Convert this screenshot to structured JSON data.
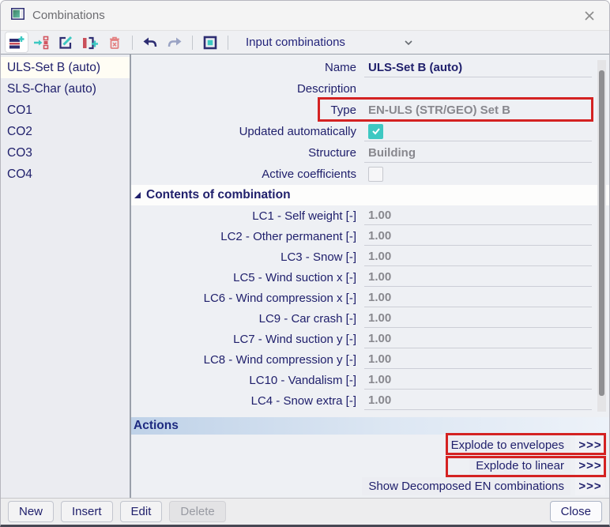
{
  "window": {
    "title": "Combinations"
  },
  "toolbar": {
    "dropdown_value": "Input combinations",
    "icons": [
      "new-combination",
      "move-combination",
      "edit-combination",
      "insert-combination",
      "delete-combination",
      "undo",
      "redo",
      "manager-box",
      "chevron-down"
    ]
  },
  "sidebar": {
    "items": [
      {
        "label": "ULS-Set B (auto)",
        "selected": true
      },
      {
        "label": "SLS-Char (auto)",
        "selected": false
      },
      {
        "label": "CO1",
        "selected": false
      },
      {
        "label": "CO2",
        "selected": false
      },
      {
        "label": "CO3",
        "selected": false
      },
      {
        "label": "CO4",
        "selected": false
      }
    ]
  },
  "properties": {
    "name": {
      "label": "Name",
      "value": "ULS-Set B (auto)"
    },
    "description": {
      "label": "Description",
      "value": ""
    },
    "type": {
      "label": "Type",
      "value": "EN-ULS (STR/GEO) Set B",
      "highlighted": true
    },
    "updated": {
      "label": "Updated automatically",
      "checked": true
    },
    "structure": {
      "label": "Structure",
      "value": "Building"
    },
    "active_coeff": {
      "label": "Active coefficients",
      "checked": false
    }
  },
  "contents": {
    "header": "Contents of combination",
    "rows": [
      {
        "label": "LC1 - Self weight [-]",
        "value": "1.00"
      },
      {
        "label": "LC2 - Other permanent [-]",
        "value": "1.00"
      },
      {
        "label": "LC3 - Snow [-]",
        "value": "1.00"
      },
      {
        "label": "LC5 - Wind suction x [-]",
        "value": "1.00"
      },
      {
        "label": "LC6 - Wind compression x [-]",
        "value": "1.00"
      },
      {
        "label": "LC9 - Car crash [-]",
        "value": "1.00"
      },
      {
        "label": "LC7 - Wind suction y [-]",
        "value": "1.00"
      },
      {
        "label": "LC8 - Wind compression y [-]",
        "value": "1.00"
      },
      {
        "label": "LC10 - Vandalism [-]",
        "value": "1.00"
      },
      {
        "label": "LC4 - Snow extra [-]",
        "value": "1.00"
      }
    ]
  },
  "actions": {
    "header": "Actions",
    "items": [
      {
        "label": "Explode to envelopes",
        "chevrons": ">>>",
        "highlighted": true
      },
      {
        "label": "Explode to linear",
        "chevrons": ">>>",
        "highlighted": true
      },
      {
        "label": "Show Decomposed EN combinations",
        "chevrons": ">>>",
        "highlighted": false
      }
    ]
  },
  "footer": {
    "buttons": [
      {
        "label": "New",
        "disabled": false
      },
      {
        "label": "Insert",
        "disabled": false
      },
      {
        "label": "Edit",
        "disabled": false
      },
      {
        "label": "Delete",
        "disabled": true
      }
    ],
    "close_label": "Close"
  },
  "colors": {
    "accent_teal": "#3EC8C2",
    "navy_text": "#20206C",
    "highlight_red": "#D42222",
    "selected_item_bg": "#FFFDF4",
    "actions_header_gradient": [
      "#BFD2E8",
      "#EDF2F9"
    ]
  }
}
